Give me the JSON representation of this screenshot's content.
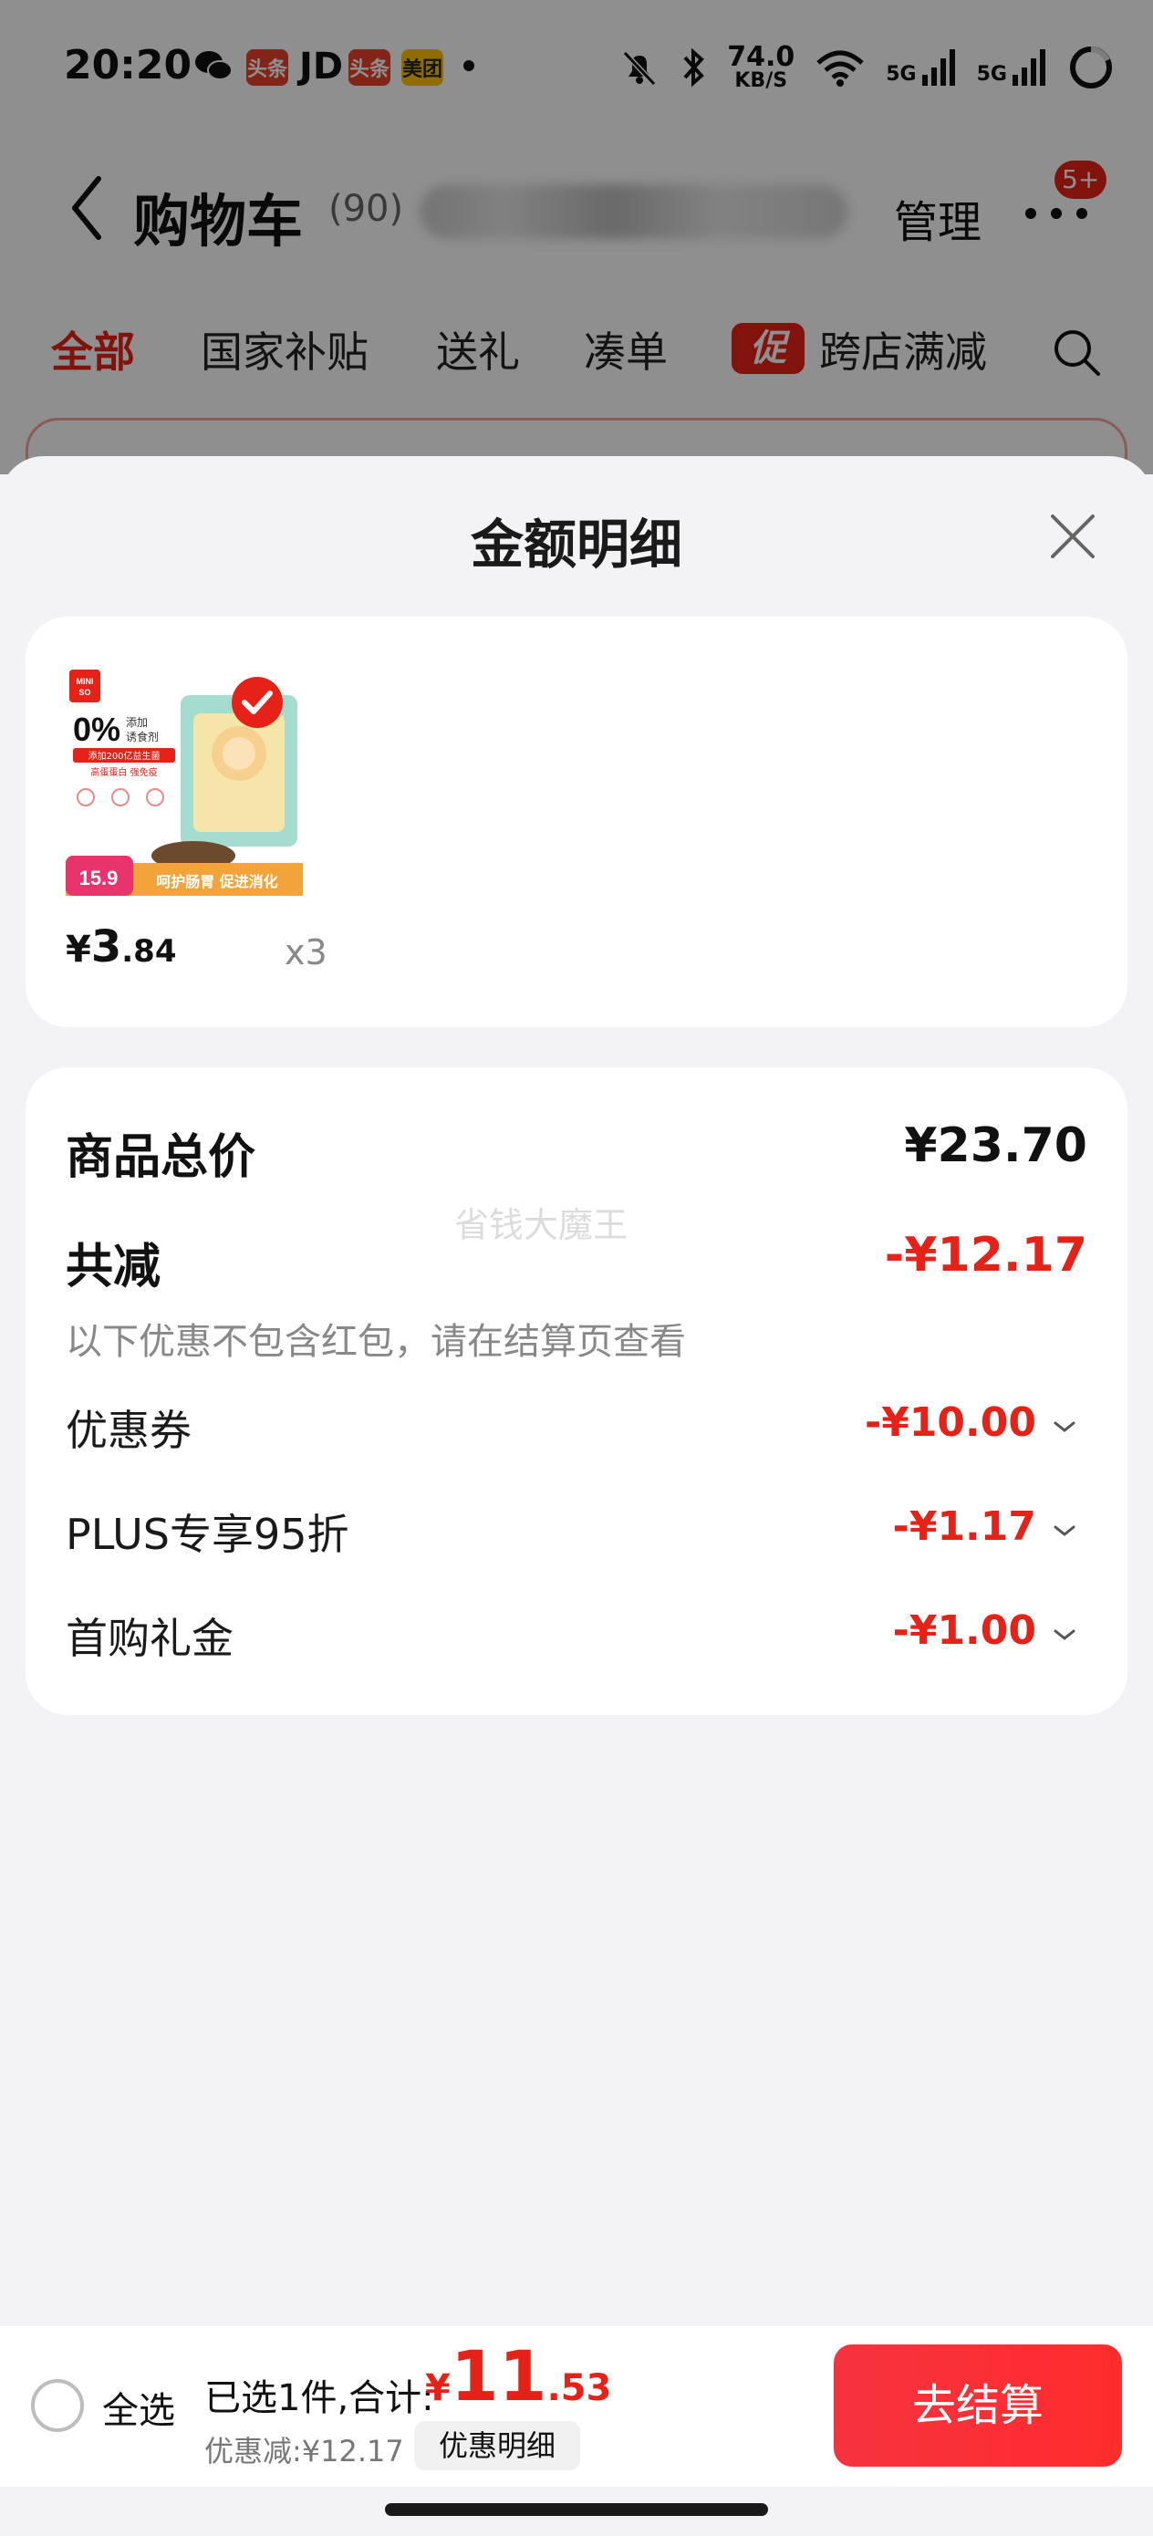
{
  "status_bar": {
    "time": "20:20",
    "apps": [
      {
        "label": "头条",
        "color": "#e8402a"
      },
      {
        "label": "JD",
        "color": "#111111"
      },
      {
        "label": "头条",
        "color": "#e8402a"
      },
      {
        "label": "美团",
        "color": "#ffc300"
      }
    ],
    "net_speed_value": "74.0",
    "net_speed_unit": "KB/S",
    "network_1": "5G",
    "network_2": "5G"
  },
  "nav": {
    "title": "购物车",
    "count": "(90)",
    "manage_label": "管理",
    "more_badge": "5+"
  },
  "tabs": [
    {
      "label": "全部",
      "active": true
    },
    {
      "label": "国家补贴",
      "active": false
    },
    {
      "label": "送礼",
      "active": false
    },
    {
      "label": "凑单",
      "active": false
    },
    {
      "label": "跨店满减",
      "active": false
    }
  ],
  "promo_badge": "促",
  "sheet": {
    "title": "金额明细",
    "product": {
      "image_texts": {
        "brand": "MINI\nSO",
        "headline": "0%",
        "headline_side": "添加\n诱食剂",
        "tagline": "添加200亿益生菌",
        "sub": "高蛋蛋白 强免疫",
        "price_tag": "15.9",
        "banner": "呵护肠胃 促进消化"
      },
      "price_symbol": "¥",
      "price_int": "3",
      "price_dec": ".84",
      "quantity": "x3"
    },
    "summary": {
      "total_label": "商品总价",
      "total_value": "¥23.70",
      "reduce_label": "共减",
      "reduce_value": "-¥12.17",
      "note": "以下优惠不包含红包，请在结算页查看",
      "watermark": "省钱大魔王",
      "items": [
        {
          "label": "优惠券",
          "value": "-¥10.00"
        },
        {
          "label": "PLUS专享95折",
          "value": "-¥1.17"
        },
        {
          "label": "首购礼金",
          "value": "-¥1.00"
        }
      ]
    }
  },
  "bottom_bar": {
    "select_all_label": "全选",
    "selected_count": "已选1件,合计:",
    "total_symbol": "¥",
    "total_int": "11",
    "total_dec": ".53",
    "discount_note": "优惠减:¥12.17",
    "detail_button": "优惠明细",
    "checkout_button": "去结算"
  },
  "colors": {
    "accent_red": "#e62117",
    "sheet_bg": "#f3f3f5",
    "card_bg": "#ffffff"
  }
}
